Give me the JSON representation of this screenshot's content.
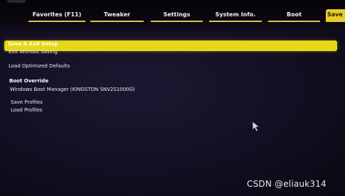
{
  "tabs": [
    {
      "label": "Favorites (F11)"
    },
    {
      "label": "Tweaker"
    },
    {
      "label": "Settings"
    },
    {
      "label": "System Info."
    },
    {
      "label": "Boot"
    },
    {
      "label": "Save & Exit",
      "active": true
    }
  ],
  "menu": {
    "save_exit_setup": "Save & Exit Setup",
    "exit_without_saving": "Exit Without Saving",
    "load_optimized_defaults": "Load Optimized Defaults",
    "boot_override_heading": "Boot Override",
    "boot_entries": [
      "Windows Boot Manager (KINGSTON SNV2S1000G)"
    ],
    "save_profiles": "Save Profiles",
    "load_profiles": "Load Profiles"
  },
  "watermark": "CSDN @eliauk314",
  "colors": {
    "highlight": "#e6d719",
    "tab_underline": "#e0c35a",
    "background": "#151020"
  }
}
